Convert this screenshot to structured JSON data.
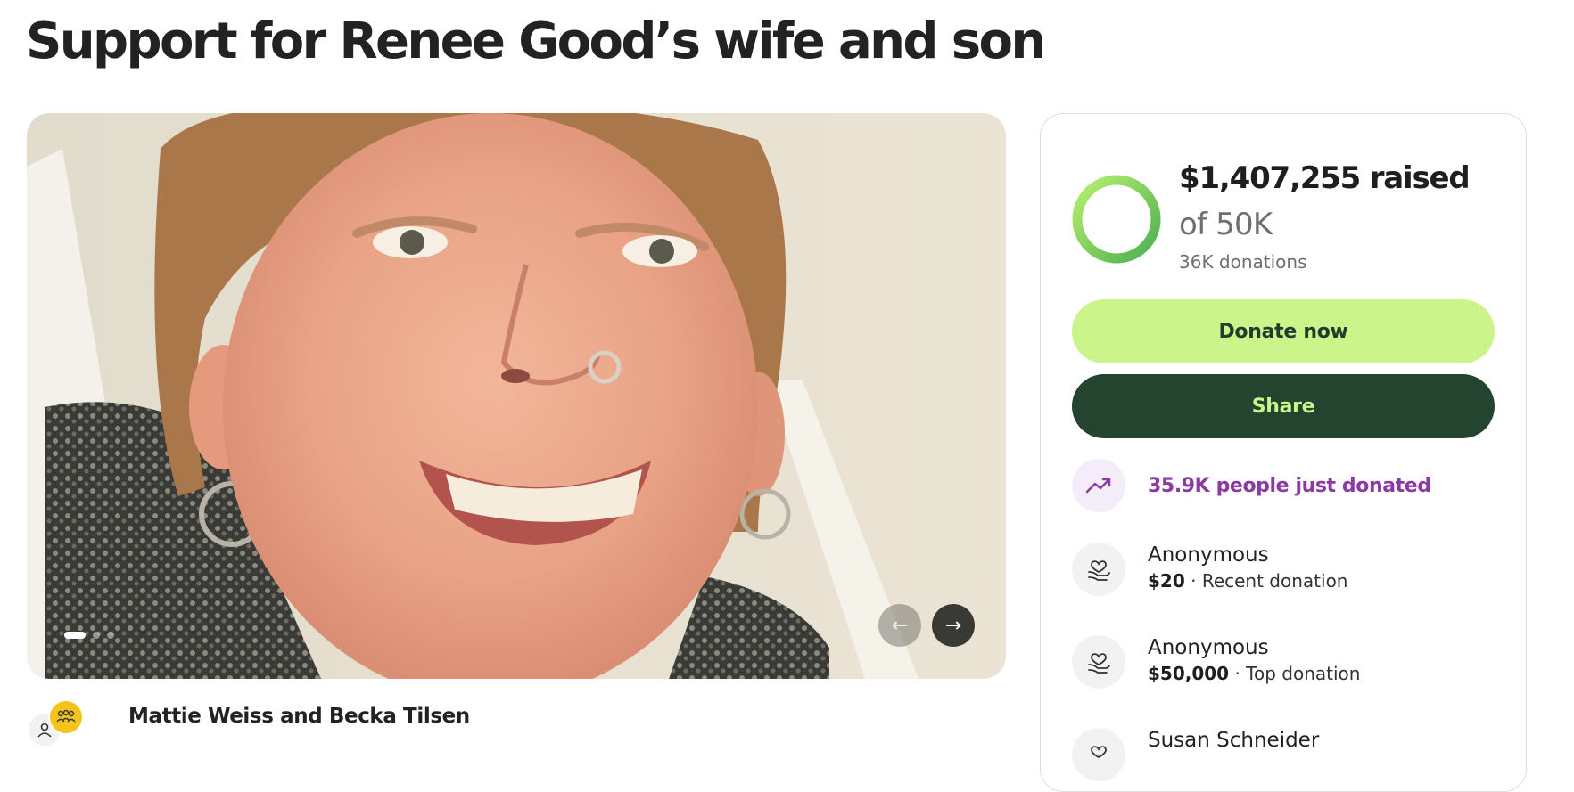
{
  "page": {
    "title": "Support for Renee Good’s wife and son"
  },
  "gallery": {
    "image_alt": "Smiling woman with short auburn hair, nose ring and hoop earrings",
    "slide_count": 3,
    "active_slide": 1,
    "prev_icon": "arrow-left-icon",
    "next_icon": "arrow-right-icon"
  },
  "organizer": {
    "name": "Mattie Weiss and Becka Tilsen"
  },
  "donation_card": {
    "raised": "$1,407,255 raised",
    "goal": "of 50K",
    "donations": "36K donations",
    "progress_fraction": 1.0,
    "donate_label": "Donate now",
    "share_label": "Share",
    "trend_text": "35.9K people just donated",
    "colors": {
      "donate_bg": "#cbf58a",
      "share_bg": "#24442f",
      "trend_text": "#8a3aa2",
      "ring_start": "#4caf50",
      "ring_end": "#b8f070"
    },
    "donors": [
      {
        "name": "Anonymous",
        "amount": "$20",
        "note": " · Recent donation"
      },
      {
        "name": "Anonymous",
        "amount": "$50,000",
        "note": " · Top donation"
      },
      {
        "name": "Susan Schneider",
        "amount": "",
        "note": ""
      }
    ]
  }
}
